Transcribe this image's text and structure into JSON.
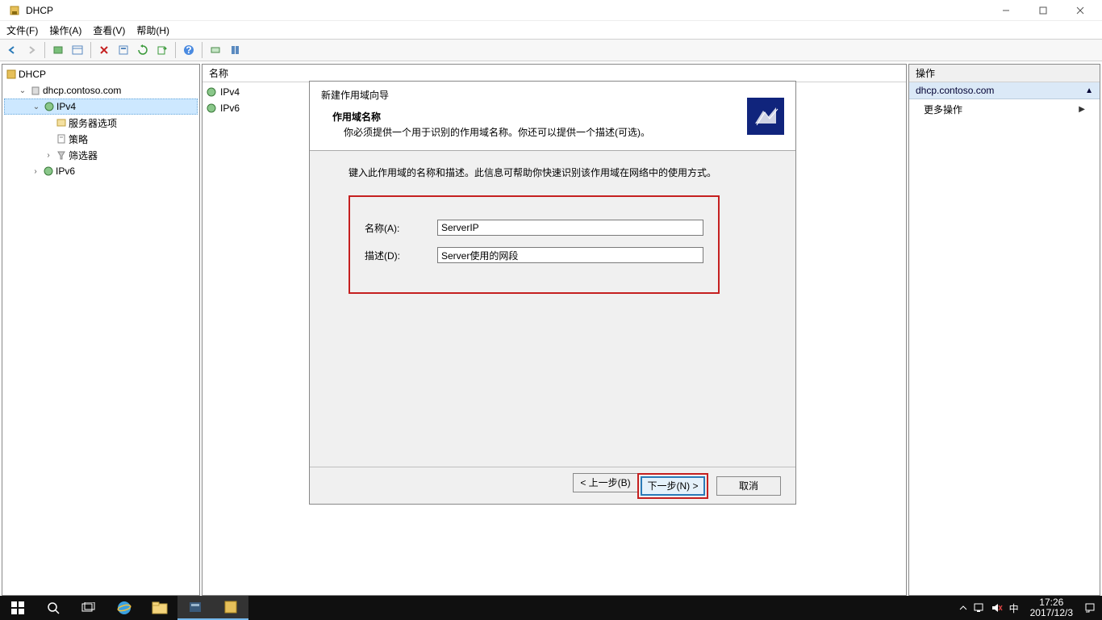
{
  "titlebar": {
    "title": "DHCP"
  },
  "menu": {
    "file": "文件(F)",
    "action": "操作(A)",
    "view": "查看(V)",
    "help": "帮助(H)"
  },
  "tree": {
    "root": "DHCP",
    "server": "dhcp.contoso.com",
    "ipv4": "IPv4",
    "server_options": "服务器选项",
    "policy": "策略",
    "filters": "筛选器",
    "ipv6": "IPv6"
  },
  "mid": {
    "header": "名称",
    "items": [
      "IPv4",
      "IPv6"
    ]
  },
  "actions": {
    "header": "操作",
    "section": "dhcp.contoso.com",
    "more": "更多操作"
  },
  "wizard": {
    "title": "新建作用域向导",
    "heading": "作用域名称",
    "subheading": "你必须提供一个用于识别的作用域名称。你还可以提供一个描述(可选)。",
    "bodydesc": "键入此作用域的名称和描述。此信息可帮助你快速识别该作用域在网络中的使用方式。",
    "name_lbl": "名称(A):",
    "name_val": "ServerIP",
    "desc_lbl": "描述(D):",
    "desc_val": "Server使用的网段",
    "back": "< 上一步(B)",
    "next": "下一步(N) >",
    "cancel": "取消"
  },
  "taskbar": {
    "time": "17:26",
    "date": "2017/12/3",
    "ime": "中"
  }
}
